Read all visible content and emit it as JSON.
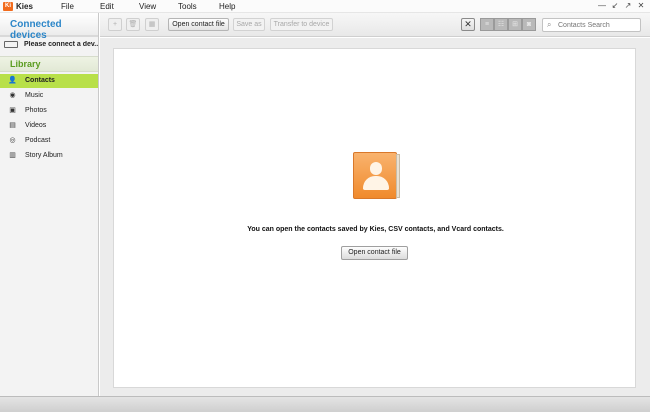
{
  "app": {
    "logo": "Ki",
    "name": "Kies"
  },
  "menu": [
    "File",
    "Edit",
    "View",
    "Tools",
    "Help"
  ],
  "window_controls": {
    "minimize": "—",
    "restore": "↙",
    "maximize": "↗",
    "close": "✕"
  },
  "sidebar": {
    "connected_header": "Connected devices",
    "device_label": "Please connect a dev...",
    "library_header": "Library",
    "items": [
      {
        "label": "Contacts",
        "icon": "contacts-icon",
        "glyph": "👤",
        "active": true
      },
      {
        "label": "Music",
        "icon": "music-icon",
        "glyph": "◉",
        "active": false
      },
      {
        "label": "Photos",
        "icon": "photos-icon",
        "glyph": "▣",
        "active": false
      },
      {
        "label": "Videos",
        "icon": "videos-icon",
        "glyph": "▤",
        "active": false
      },
      {
        "label": "Podcast",
        "icon": "podcast-icon",
        "glyph": "◎",
        "active": false
      },
      {
        "label": "Story Album",
        "icon": "story-album-icon",
        "glyph": "▥",
        "active": false
      }
    ]
  },
  "toolbar": {
    "add_glyph": "+",
    "delete_glyph": "🗑",
    "grid_glyph": "▦",
    "open_contact_file": "Open contact file",
    "save_as": "Save as",
    "transfer_to_device": "Transfer to device",
    "close_view_glyph": "✕",
    "view_glyphs": [
      "≡",
      "☷",
      "⊞",
      "◙"
    ],
    "search_placeholder": "Contacts Search",
    "search_glyph": "⌕"
  },
  "main": {
    "message": "You can open the contacts saved by Kies, CSV contacts, and Vcard contacts.",
    "open_button": "Open contact file"
  },
  "colors": {
    "accent_blue": "#2c86c8",
    "library_green": "#5a9c1f",
    "active_item": "#b8e049",
    "contact_orange": "#f08a2c",
    "logo_orange": "#f26b1d"
  }
}
